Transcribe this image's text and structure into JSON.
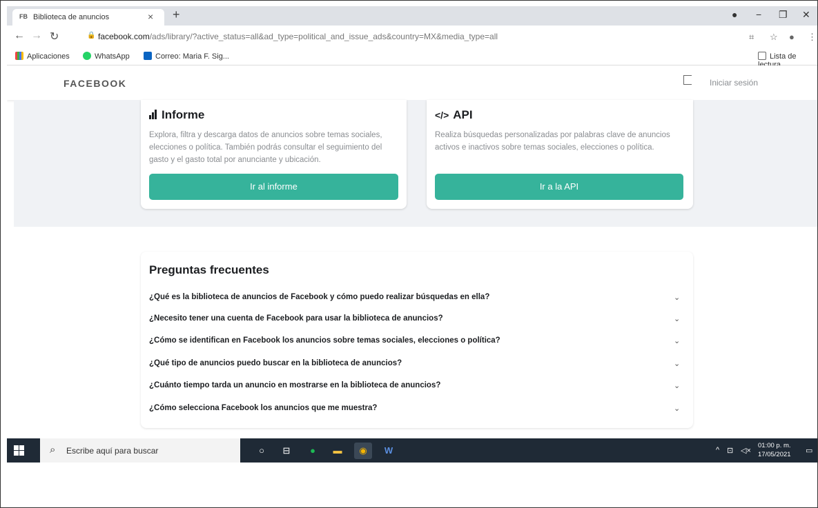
{
  "browser": {
    "tab_title": "Biblioteca de anuncios",
    "tab_favicon": "FB",
    "url_host": "facebook.com",
    "url_path": "/ads/library/?active_status=all&ad_type=political_and_issue_ads&country=MX&media_type=all"
  },
  "bookmarks": {
    "apps": "Aplicaciones",
    "whatsapp": "WhatsApp",
    "mail": "Correo: Maria F. Sig...",
    "reading_list": "Lista de lectura"
  },
  "header": {
    "logo": "FACEBOOK",
    "login": "Iniciar sesión"
  },
  "cards": {
    "report": {
      "title": "Informe",
      "text": "Explora, filtra y descarga datos de anuncios sobre temas sociales, elecciones o política. También podrás consultar el seguimiento del gasto y el gasto total por anunciante y ubicación.",
      "button": "Ir al informe"
    },
    "api": {
      "title": "API",
      "icon_text": "</>",
      "text": "Realiza búsquedas personalizadas por palabras clave de anuncios activos e inactivos sobre temas sociales, elecciones o política.",
      "button": "Ir a la API"
    }
  },
  "faq": {
    "title": "Preguntas frecuentes",
    "items": [
      "¿Qué es la biblioteca de anuncios de Facebook y cómo puedo realizar búsquedas en ella?",
      "¿Necesito tener una cuenta de Facebook para usar la biblioteca de anuncios?",
      "¿Cómo se identifican en Facebook los anuncios sobre temas sociales, elecciones o política?",
      "¿Qué tipo de anuncios puedo buscar en la biblioteca de anuncios?",
      "¿Cuánto tiempo tarda un anuncio en mostrarse en la biblioteca de anuncios?",
      "¿Cómo selecciona Facebook los anuncios que me muestra?"
    ]
  },
  "taskbar": {
    "search_placeholder": "Escribe aquí para buscar",
    "time": "01:00 p. m.",
    "date": "17/05/2021"
  },
  "colors": {
    "accent_green": "#36b39b",
    "taskbar": "#1f2a36"
  }
}
